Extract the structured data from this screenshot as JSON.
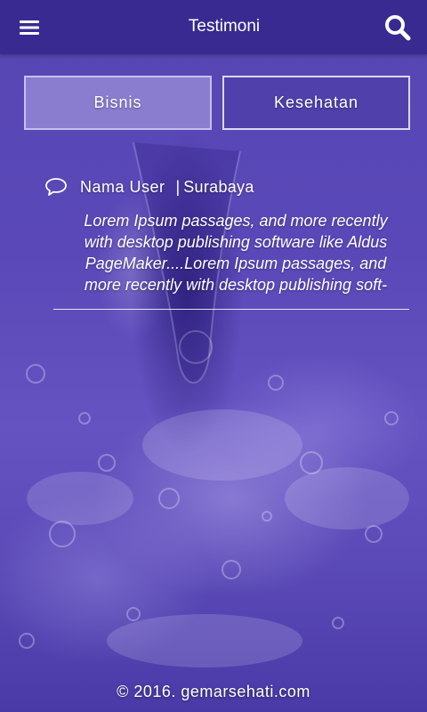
{
  "appbar": {
    "title": "Testimoni",
    "menu_icon": "hamburger-menu-icon",
    "search_icon": "search-icon",
    "background": "#392a92"
  },
  "tabs": [
    {
      "label": "Bisnis",
      "selected": true
    },
    {
      "label": "Kesehatan",
      "selected": false
    }
  ],
  "testimonial": {
    "icon": "chat-bubble-icon",
    "name": "Nama User",
    "separator": "|",
    "city": "Surabaya",
    "text": "Lorem Ipsum passages, and more recently with desktop publishing software like Aldus PageMaker....Lorem Ipsum passages, and more recently with desktop publishing soft-"
  },
  "footer": {
    "copyright": "© 2016. gemarsehati.com"
  },
  "colors": {
    "accent": "#392a92",
    "background": "#5a48b8",
    "text": "#ffffff"
  }
}
